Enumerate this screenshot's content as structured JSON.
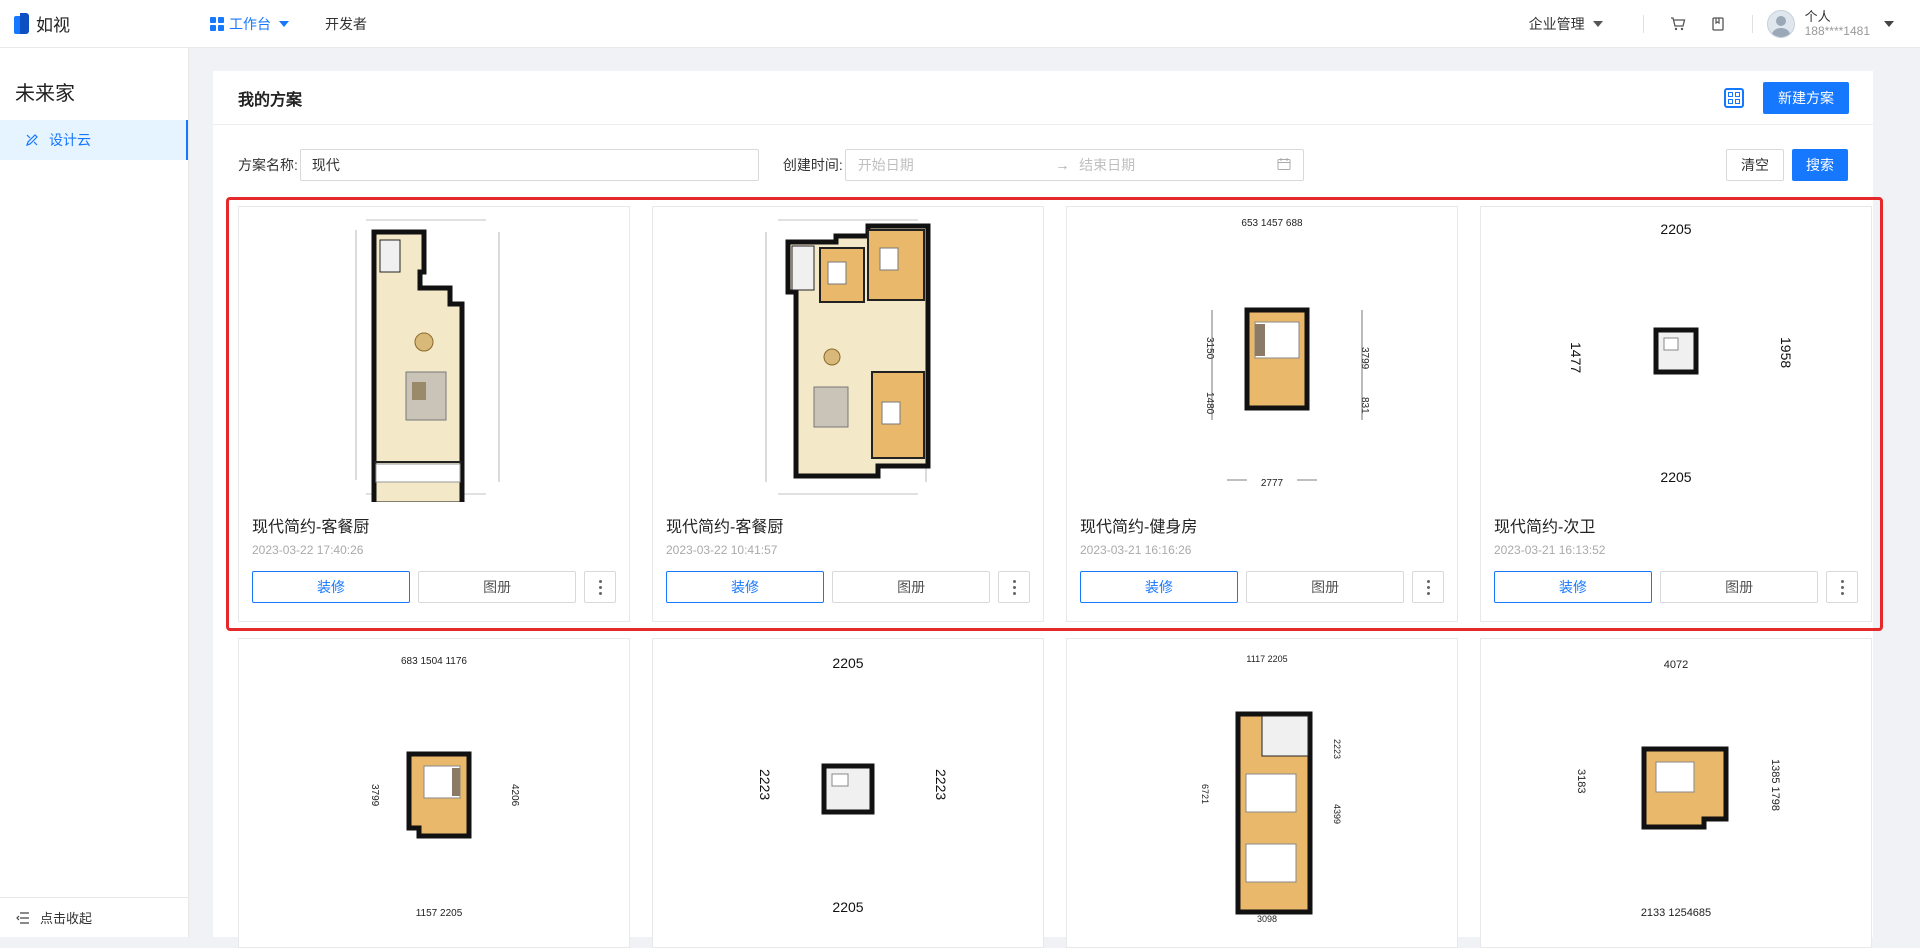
{
  "app": {
    "logo_text": "如视"
  },
  "nav": [
    {
      "label": "工作台",
      "active": true
    },
    {
      "label": "开发者",
      "active": false
    }
  ],
  "topright": {
    "enterprise_label": "企业管理",
    "cart_icon": "cart-icon",
    "doc_icon": "document-icon",
    "user_name": "个人",
    "user_phone": "188****1481"
  },
  "sidebar": {
    "title": "未来家",
    "items": [
      {
        "label": "设计云",
        "icon": "design-cloud-icon"
      }
    ],
    "collapse_label": "点击收起"
  },
  "main": {
    "title": "我的方案",
    "new_button": "新建方案",
    "filter": {
      "name_label": "方案名称:",
      "name_value": "现代",
      "time_label": "创建时间:",
      "start_placeholder": "开始日期",
      "end_placeholder": "结束日期",
      "clear_button": "清空",
      "search_button": "搜索"
    },
    "cards": [
      {
        "name": "现代简约-客餐厨",
        "date": "2023-03-22 17:40:26",
        "edit": "装修",
        "album": "图册",
        "plan": "living-kitchen-a"
      },
      {
        "name": "现代简约-客餐厨",
        "date": "2023-03-22 10:41:57",
        "edit": "装修",
        "album": "图册",
        "plan": "living-kitchen-b"
      },
      {
        "name": "现代简约-健身房",
        "date": "2023-03-21 16:16:26",
        "edit": "装修",
        "album": "图册",
        "plan": "gym"
      },
      {
        "name": "现代简约-次卫",
        "date": "2023-03-21 16:13:52",
        "edit": "装修",
        "album": "图册",
        "plan": "bathroom"
      },
      {
        "name": "",
        "date": "",
        "plan": "bedroom-2"
      },
      {
        "name": "",
        "date": "",
        "plan": "bathroom-small"
      },
      {
        "name": "",
        "date": "",
        "plan": "bedroom-bath"
      },
      {
        "name": "",
        "date": "",
        "plan": "bedroom-b"
      }
    ],
    "plan_labels": {
      "c3_top": "653 1457 688",
      "c3_left": "3150",
      "c3_left2": "1480",
      "c3_right": "3799",
      "c3_right2": "831",
      "c3_bottom": "2777",
      "c4_top": "2205",
      "c4_left": "1477",
      "c4_right": "1958",
      "c4_bottom": "2205",
      "c5_top": "683 1504 1176",
      "c5_left": "3799",
      "c5_right": "4206",
      "c5_bottom": "1157 2205",
      "c6_top": "2205",
      "c6_left": "2223",
      "c6_right": "2223",
      "c6_bottom": "2205",
      "c7_top": "1117 2205",
      "c7_right": "2223",
      "c7_right2": "4399",
      "c7_left": "6721",
      "c7_bottom": "3098",
      "c8_top": "4072",
      "c8_left": "3183",
      "c8_right": "1385 1798",
      "c8_bottom": "2133 1254685"
    }
  }
}
